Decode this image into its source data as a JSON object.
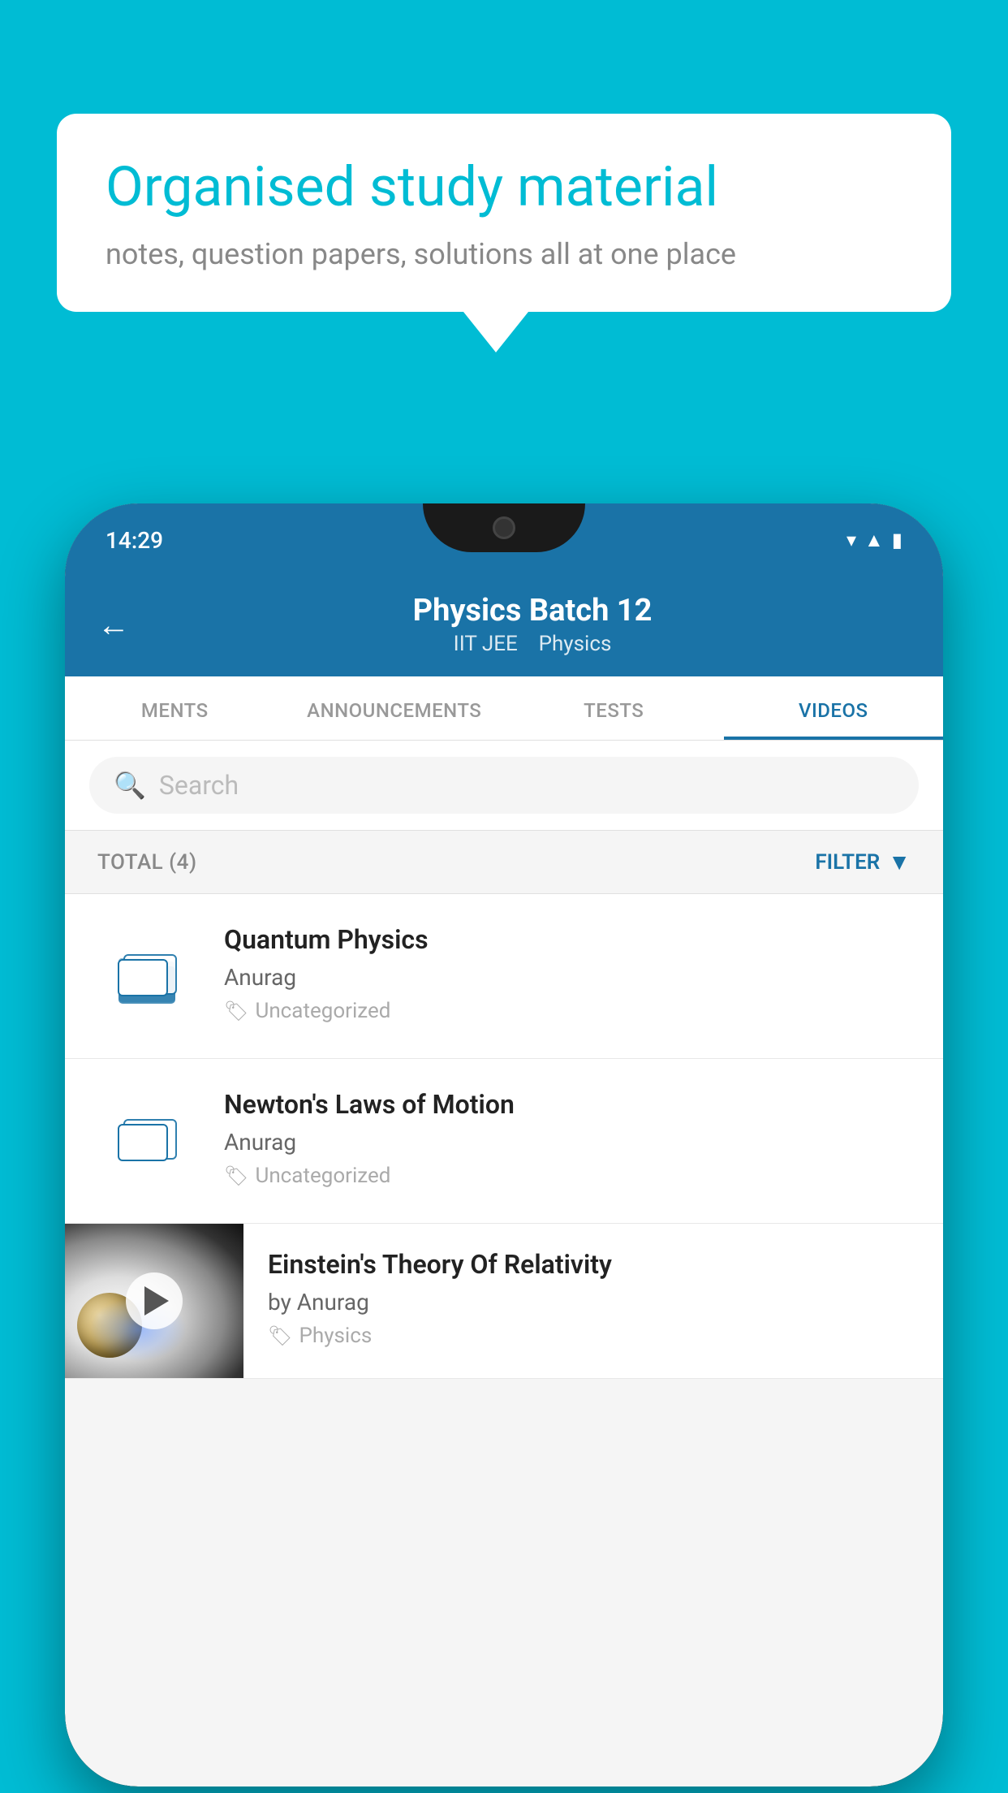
{
  "background_color": "#00bcd4",
  "speech_bubble": {
    "title": "Organised study material",
    "subtitle": "notes, question papers, solutions all at one place"
  },
  "status_bar": {
    "time": "14:29",
    "icons": [
      "wifi",
      "signal",
      "battery"
    ]
  },
  "header": {
    "title": "Physics Batch 12",
    "subtitle_part1": "IIT JEE",
    "subtitle_part2": "Physics",
    "back_label": "←"
  },
  "tabs": [
    {
      "label": "MENTS",
      "active": false
    },
    {
      "label": "ANNOUNCEMENTS",
      "active": false
    },
    {
      "label": "TESTS",
      "active": false
    },
    {
      "label": "VIDEOS",
      "active": true
    }
  ],
  "search": {
    "placeholder": "Search"
  },
  "filter_row": {
    "total_label": "TOTAL (4)",
    "filter_label": "FILTER"
  },
  "videos": [
    {
      "id": 1,
      "title": "Quantum Physics",
      "author": "Anurag",
      "tag": "Uncategorized",
      "type": "folder"
    },
    {
      "id": 2,
      "title": "Newton's Laws of Motion",
      "author": "Anurag",
      "tag": "Uncategorized",
      "type": "folder"
    },
    {
      "id": 3,
      "title": "Einstein's Theory Of Relativity",
      "author": "by Anurag",
      "tag": "Physics",
      "type": "video"
    }
  ]
}
